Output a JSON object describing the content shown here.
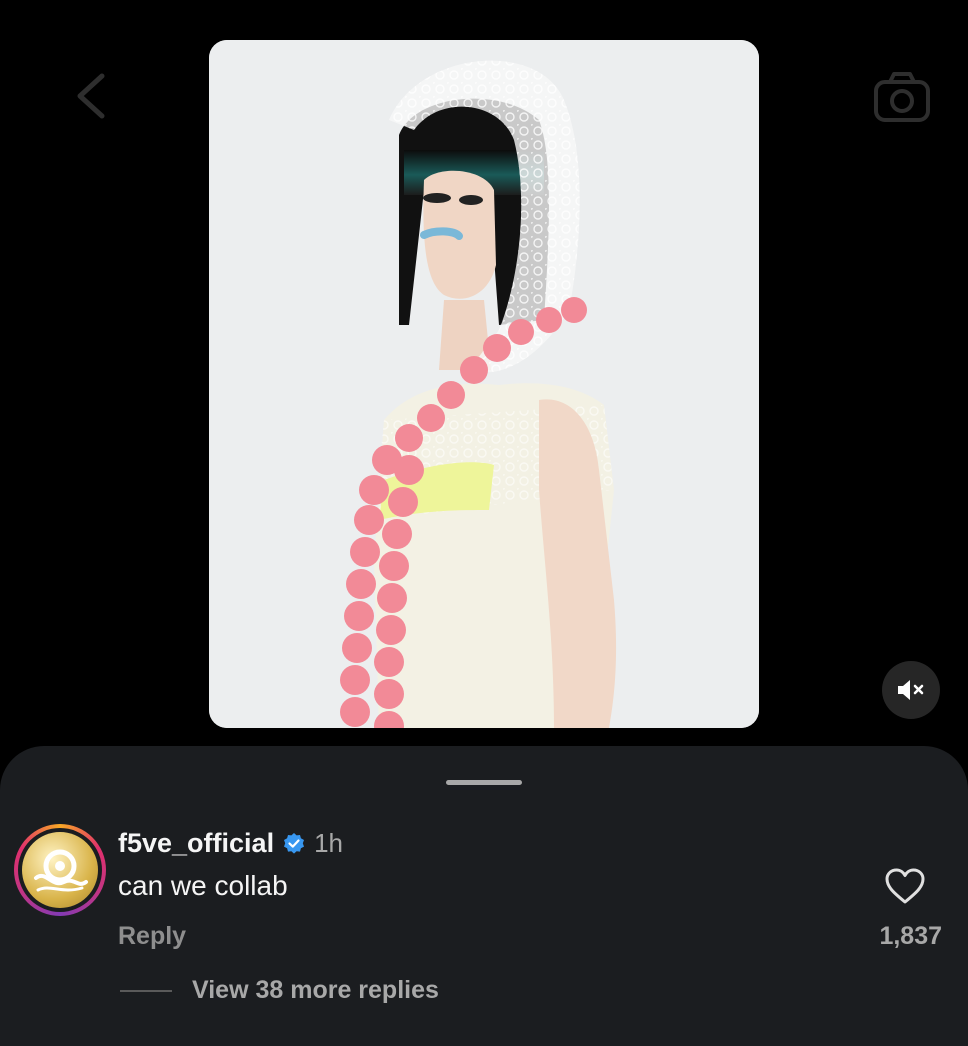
{
  "comment": {
    "username": "f5ve_official",
    "verified": true,
    "time": "1h",
    "text": "can we collab",
    "reply_label": "Reply",
    "like_count": "1,837",
    "view_more_label": "View 38 more replies"
  },
  "icons": {
    "back": "chevron-left-icon",
    "camera": "camera-icon",
    "mute": "speaker-muted-icon",
    "like": "heart-outline-icon",
    "verified": "verified-badge-icon"
  },
  "colors": {
    "background": "#000000",
    "sheet": "#1b1d20",
    "verified": "#3897f0",
    "muted_text": "#a8a8a8"
  }
}
